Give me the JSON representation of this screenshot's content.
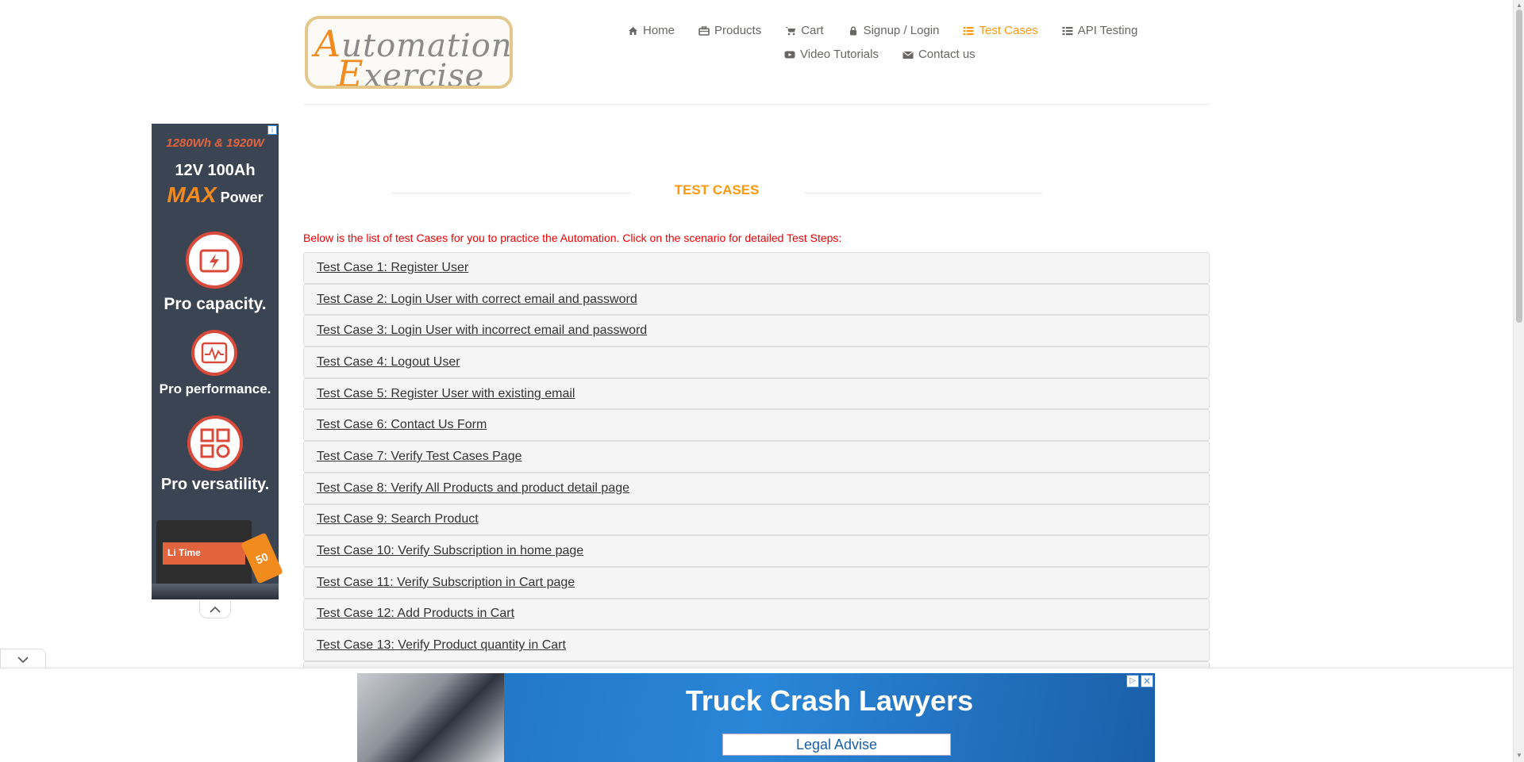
{
  "header": {
    "logo": {
      "line1": "Automation",
      "line2": "Exercise"
    },
    "nav_row1": [
      {
        "label": "Home",
        "icon": "home-icon",
        "active": false
      },
      {
        "label": "Products",
        "icon": "products-icon",
        "active": false
      },
      {
        "label": "Cart",
        "icon": "cart-icon",
        "active": false
      },
      {
        "label": "Signup / Login",
        "icon": "lock-icon",
        "active": false
      },
      {
        "label": "Test Cases",
        "icon": "list-icon",
        "active": true
      },
      {
        "label": "API Testing",
        "icon": "list-icon",
        "active": false
      }
    ],
    "nav_row2": [
      {
        "label": "Video Tutorials",
        "icon": "youtube-icon",
        "active": false
      },
      {
        "label": "Contact us",
        "icon": "envelope-icon",
        "active": false
      }
    ]
  },
  "side_ad": {
    "line1": "1280Wh & 1920W",
    "line2": "12V 100Ah",
    "max": "MAX",
    "power": "Power",
    "pro1": "Pro capacity.",
    "pro2": "Pro performance.",
    "pro3": "Pro versatility.",
    "brand": "Li Time",
    "tag": "50"
  },
  "main": {
    "title": "TEST CASES",
    "intro": "Below is the list of test Cases for you to practice the Automation. Click on the scenario for detailed Test Steps:",
    "cases": [
      "Test Case 1: Register User",
      "Test Case 2: Login User with correct email and password",
      "Test Case 3: Login User with incorrect email and password",
      "Test Case 4: Logout User",
      "Test Case 5: Register User with existing email",
      "Test Case 6: Contact Us Form",
      "Test Case 7: Verify Test Cases Page",
      "Test Case 8: Verify All Products and product detail page",
      "Test Case 9: Search Product",
      "Test Case 10: Verify Subscription in home page",
      "Test Case 11: Verify Subscription in Cart page",
      "Test Case 12: Add Products in Cart",
      "Test Case 13: Verify Product quantity in Cart"
    ]
  },
  "bottom_ad": {
    "headline": "Truck Crash Lawyers",
    "cta": "Legal Advise"
  },
  "colors": {
    "accent": "#fe980f",
    "intro_red": "#ee0000",
    "nav_text": "#696763"
  }
}
